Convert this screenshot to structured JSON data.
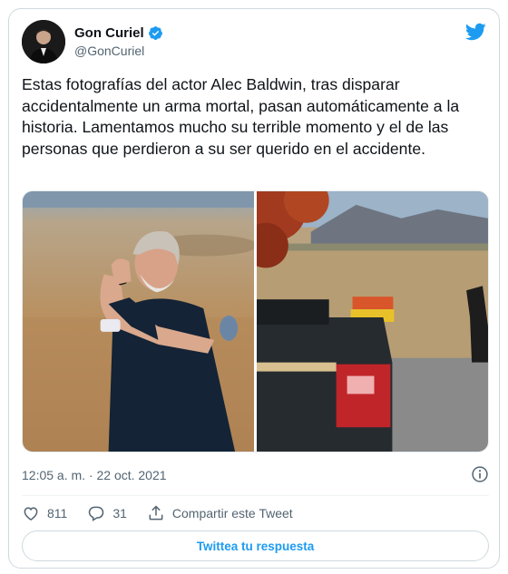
{
  "author": {
    "name": "Gon Curiel",
    "handle": "@GonCuriel"
  },
  "tweet": {
    "text": "Estas fotografías del actor Alec Baldwin, tras disparar accidentalmente un arma mortal, pasan automáticamente a la historia. Lamentamos mucho su terrible momento y el de las personas que perdieron a su ser querido en el accidente.",
    "timestamp": "12:05 a. m. · 22 oct. 2021"
  },
  "media": {
    "photos": [
      "photo-man-on-phone",
      "photo-truck-field"
    ]
  },
  "actions": {
    "likes": "811",
    "replies": "31",
    "share_label": "Compartir este Tweet"
  },
  "reply_button": "Twittea tu respuesta",
  "colors": {
    "accent": "#1d9bf0",
    "text": "#0f1419",
    "secondary": "#536471",
    "border": "#cfd9de"
  },
  "icons": [
    "verified-icon",
    "twitter-bird-icon",
    "info-icon",
    "heart-icon",
    "reply-icon",
    "share-icon"
  ]
}
